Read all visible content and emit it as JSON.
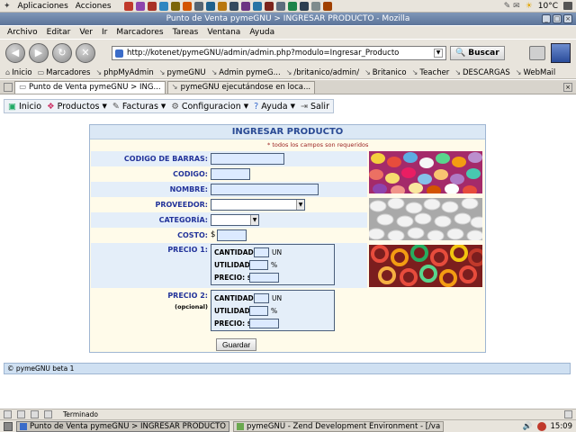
{
  "desktop": {
    "menus": [
      "Aplicaciones",
      "Acciones"
    ],
    "weather": "10°C",
    "clock": "15:09"
  },
  "window": {
    "title": "Punto de Venta pymeGNU > INGRESAR PRODUCTO - Mozilla"
  },
  "browser": {
    "menu": [
      "Archivo",
      "Editar",
      "Ver",
      "Ir",
      "Marcadores",
      "Tareas",
      "Ventana",
      "Ayuda"
    ],
    "url": "http://kotenet/pymeGNU/admin/admin.php?modulo=Ingresar_Producto",
    "search_label": "Buscar",
    "bookmarks": [
      "Inicio",
      "Marcadores",
      "phpMyAdmin",
      "pymeGNU",
      "Admin pymeG...",
      "/britanico/admin/",
      "Britanico",
      "Teacher",
      "DESCARGAS",
      "WebMail"
    ],
    "tabs": [
      "Punto de Venta pymeGNU > ING...",
      "pymeGNU ejecutándose en loca..."
    ],
    "status": "Terminado"
  },
  "app_menu": [
    {
      "label": "Inicio",
      "caret": false
    },
    {
      "label": "Productos",
      "caret": true
    },
    {
      "label": "Facturas",
      "caret": true
    },
    {
      "label": "Configuracion",
      "caret": true
    },
    {
      "label": "Ayuda",
      "caret": true
    },
    {
      "label": "Salir",
      "caret": false
    }
  ],
  "form": {
    "title": "INGRESAR PRODUCTO",
    "required_note": "* todos los campos son requeridos",
    "labels": {
      "barcode": "CODIGO DE BARRAS:",
      "code": "CODIGO:",
      "name": "NOMBRE:",
      "supplier": "PROVEEDOR:",
      "category": "CATEGORÍA:",
      "cost": "COSTO:",
      "price1": "PRECIO 1:",
      "price2": "PRECIO 2:",
      "optional": "(opcional)"
    },
    "currency": "$",
    "price_box": {
      "quantity": "CANTIDAD:",
      "unit": "UN",
      "utility": "UTILIDAD:",
      "percent": "%",
      "price": "PRECIO: $"
    },
    "submit": "Guardar"
  },
  "footer": "© pymeGNU beta 1",
  "taskbar": {
    "tasks": [
      "Punto de Venta pymeGNU > INGRESAR PRODUCTO",
      "pymeGNU - Zend Development Environment - [/va"
    ]
  }
}
